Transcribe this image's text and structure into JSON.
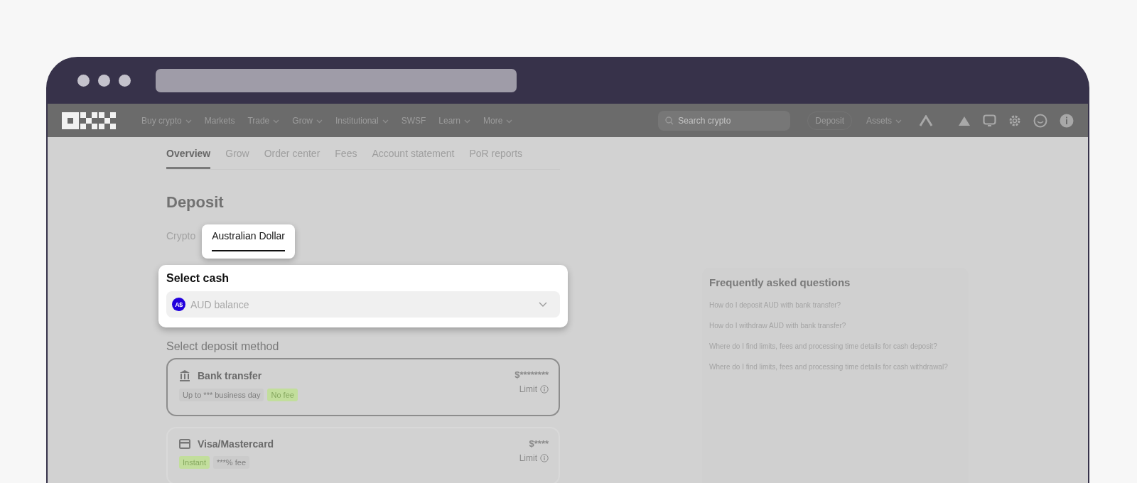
{
  "navbar": {
    "menu": [
      {
        "label": "Buy crypto",
        "has_menu": true
      },
      {
        "label": "Markets",
        "has_menu": false
      },
      {
        "label": "Trade",
        "has_menu": true
      },
      {
        "label": "Grow",
        "has_menu": true
      },
      {
        "label": "Institutional",
        "has_menu": true
      },
      {
        "label": "SWSF",
        "has_menu": false
      },
      {
        "label": "Learn",
        "has_menu": true
      },
      {
        "label": "More",
        "has_menu": true
      }
    ],
    "search": {
      "placeholder": "Search crypto"
    },
    "actions": [
      {
        "label": "Deposit",
        "kind": "button"
      },
      {
        "label": "Assets",
        "kind": "menu"
      }
    ]
  },
  "subnav": [
    {
      "label": "Overview",
      "selected": true
    },
    {
      "label": "Grow",
      "selected": false
    },
    {
      "label": "Order center",
      "selected": false
    },
    {
      "label": "Fees",
      "selected": false
    },
    {
      "label": "Account statement",
      "selected": false
    },
    {
      "label": "PoR reports",
      "selected": false
    }
  ],
  "title": "Deposit",
  "currency_tabs": [
    {
      "label": "Crypto",
      "selected": false
    },
    {
      "label": "Australian Dollar",
      "selected": true
    }
  ],
  "select_cash": {
    "label": "Select cash",
    "badge": "A$",
    "value": "AUD balance"
  },
  "deposit_method": {
    "label": "Select deposit method",
    "methods": [
      {
        "name": "Bank transfer",
        "kind": "bank",
        "selected": true,
        "tags": [
          {
            "text": "Up to *** business day",
            "kind": "plain"
          },
          {
            "text": "No fee",
            "kind": "highlight"
          }
        ],
        "amount": "$********",
        "limit": "Limit"
      },
      {
        "name": "Visa/Mastercard",
        "kind": "card",
        "selected": false,
        "tags": [
          {
            "text": "Instant",
            "kind": "highlight"
          },
          {
            "text": "***% fee",
            "kind": "plain"
          }
        ],
        "amount": "$****",
        "limit": "Limit"
      }
    ]
  },
  "faq": {
    "title": "Frequently asked questions",
    "questions": [
      "How do I deposit AUD with bank transfer?",
      "How do I withdraw AUD with bank transfer?",
      "Where do I find limits, fees and processing time details for cash deposit?",
      "Where do I find limits, fees and processing time details for cash withdrawal?"
    ]
  }
}
